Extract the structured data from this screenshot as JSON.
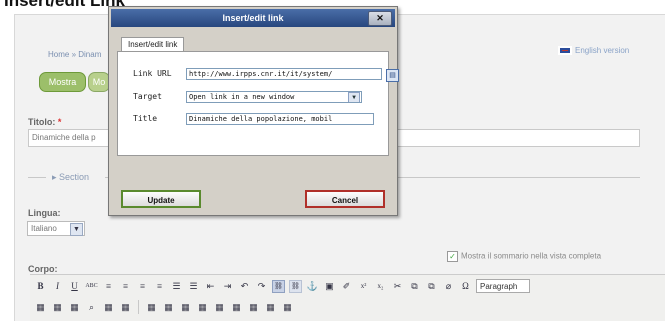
{
  "page": {
    "heading": "Insert/edit Link"
  },
  "background": {
    "breadcrumb": "Home » Dinam",
    "buttons": [
      "Mostra",
      "Mo"
    ],
    "english_link": "English version",
    "title_label": "Titolo:",
    "title_required": "*",
    "title_value": "Dinamiche della p",
    "section_label": "▸ Section",
    "lingua_label": "Lingua:",
    "lingua_value": "Italiano",
    "sommario_label": "Mostra il sommario nella vista completa",
    "corpo_label": "Corpo:",
    "format_value": "Paragraph"
  },
  "dialog": {
    "title": "Insert/edit link",
    "close_label": "✕",
    "tab_label": "Insert/edit link",
    "link_url_label": "Link URL",
    "link_url_value": "http://www.irpps.cnr.it/it/system/",
    "target_label": "Target",
    "target_value": "Open link in a new window",
    "title_label": "Title",
    "title_value": "Dinamiche della popolazione, mobil",
    "update_label": "Update",
    "cancel_label": "Cancel"
  },
  "toolbar": {
    "row1": [
      "B",
      "I",
      "U",
      "ABC",
      "≡",
      "≡",
      "≡",
      "≡",
      "☰",
      "☰",
      "⇤",
      "⇥",
      "↶",
      "↷",
      "⛓",
      "⛓",
      "⚓",
      "▣",
      "✐",
      "x²",
      "x₂",
      "✂",
      "⧉",
      "⧉",
      "⌀",
      "Ω"
    ],
    "row2": [
      "▦",
      "▦",
      "▦",
      "⌕",
      "▦",
      "▦",
      "▦",
      "▦",
      "▦",
      "▦",
      "▦",
      "▦",
      "▦",
      "▦",
      "▦"
    ]
  },
  "colors": {
    "titlebar": "#27467e",
    "update_border": "#5a8a2e",
    "cancel_border": "#b0302a"
  }
}
